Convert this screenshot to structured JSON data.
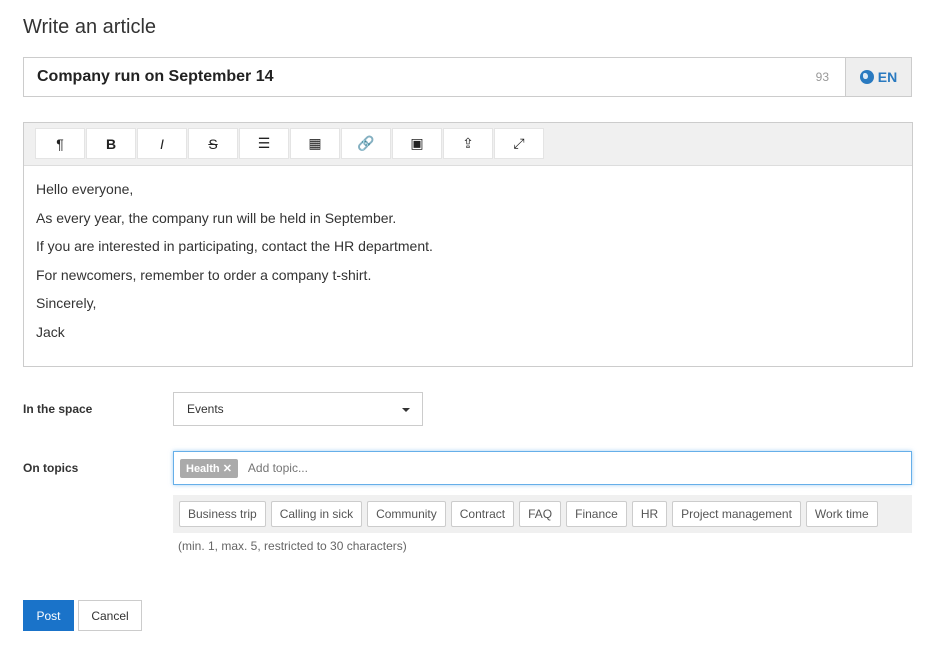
{
  "page_title": "Write an article",
  "article": {
    "title": "Company run on September 14",
    "char_count": "93",
    "language": "EN"
  },
  "toolbar": [
    {
      "icon": "paragraph-icon",
      "glyph": "¶"
    },
    {
      "icon": "bold-icon",
      "glyph": "B"
    },
    {
      "icon": "italic-icon",
      "glyph": "I"
    },
    {
      "icon": "strikethrough-icon",
      "glyph": "S"
    },
    {
      "icon": "bullet-list-icon",
      "glyph": "☰"
    },
    {
      "icon": "table-icon",
      "glyph": "▦"
    },
    {
      "icon": "link-icon",
      "glyph": "🔗"
    },
    {
      "icon": "image-icon",
      "glyph": "▣"
    },
    {
      "icon": "upload-icon",
      "glyph": "⇪"
    },
    {
      "icon": "fullscreen-icon",
      "glyph": "⤢"
    }
  ],
  "body": [
    "Hello everyone,",
    "As every year, the company run will be held in September.",
    "If you are interested in participating, contact the HR department.",
    "For newcomers, remember to order a company t-shirt.",
    "Sincerely,",
    "Jack"
  ],
  "space": {
    "label": "In the space",
    "value": "Events"
  },
  "topics": {
    "label": "On topics",
    "selected": [
      "Health"
    ],
    "placeholder": "Add topic...",
    "suggestions": [
      "Business trip",
      "Calling in sick",
      "Community",
      "Contract",
      "FAQ",
      "Finance",
      "HR",
      "Project management",
      "Work time"
    ],
    "hint": "(min. 1, max. 5, restricted to 30 characters)"
  },
  "actions": {
    "post": "Post",
    "cancel": "Cancel"
  },
  "colors": {
    "primary": "#1a73c9",
    "focus": "#66afe9"
  }
}
